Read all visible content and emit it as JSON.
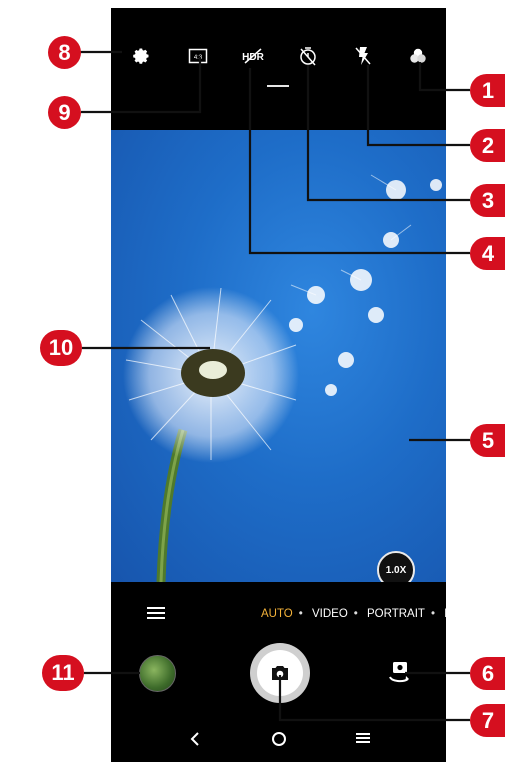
{
  "camera": {
    "top_icons": [
      "gear-icon",
      "aspect-ratio-icon",
      "hdr-off-icon",
      "timer-off-icon",
      "flash-off-icon",
      "filter-icon"
    ],
    "aspect_label": "4:3",
    "hdr_label": "HDR",
    "zoom_label": "1.0X",
    "modes": {
      "active": "AUTO",
      "items": [
        "AUTO",
        "VIDEO",
        "PORTRAIT",
        "PA"
      ],
      "separator": "•"
    }
  },
  "callouts": {
    "c1": "1",
    "c2": "2",
    "c3": "3",
    "c4": "4",
    "c5": "5",
    "c6": "6",
    "c7": "7",
    "c8": "8",
    "c9": "9",
    "c10": "10",
    "c11": "11"
  },
  "colors": {
    "callout": "#d50f1f",
    "mode_active": "#f3b23a",
    "sky": "#1e6dc8"
  }
}
